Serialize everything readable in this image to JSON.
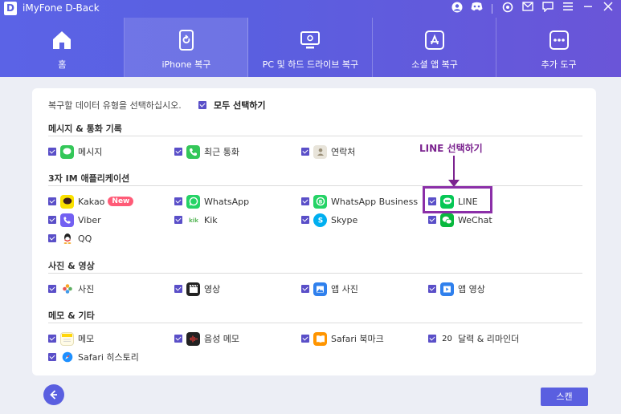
{
  "app": {
    "logo_letter": "D",
    "title": "iMyFone D-Back"
  },
  "titlebar_icons": [
    "user-icon",
    "discord-icon",
    "settings-icon",
    "mail-icon",
    "chat-icon",
    "menu-icon",
    "minimize-icon",
    "close-icon"
  ],
  "nav": {
    "tabs": [
      {
        "label": "홈",
        "icon": "home-icon",
        "active": false
      },
      {
        "label": "iPhone 복구",
        "icon": "phone-restore-icon",
        "active": true
      },
      {
        "label": "PC 및 하드 드라이브 복구",
        "icon": "monitor-icon",
        "active": false
      },
      {
        "label": "소셜 앱 복구",
        "icon": "app-store-icon",
        "active": false
      },
      {
        "label": "추가 도구",
        "icon": "more-tools-icon",
        "active": false
      }
    ]
  },
  "main": {
    "prompt": "복구할 데이터 유형을 선택하십시오.",
    "select_all_label": "모두 선택하기",
    "annotation": "LINE 선택하기",
    "sections": [
      {
        "title": "메시지 & 통화 기록",
        "items": [
          {
            "label": "메시지",
            "icon": "messages-icon",
            "color": "#34c759",
            "checked": true
          },
          {
            "label": "최근 통화",
            "icon": "phone-icon",
            "color": "#34c759",
            "checked": true
          },
          {
            "label": "연락처",
            "icon": "contacts-icon",
            "color": "#d8d3c7",
            "checked": true
          }
        ]
      },
      {
        "title": "3자 IM 애플리케이션",
        "items": [
          {
            "label": "Kakao",
            "icon": "kakao-icon",
            "color": "#fae100",
            "badge": "New",
            "checked": true
          },
          {
            "label": "WhatsApp",
            "icon": "whatsapp-icon",
            "color": "#25d366",
            "checked": true
          },
          {
            "label": "WhatsApp Business",
            "icon": "whatsapp-business-icon",
            "color": "#25d366",
            "checked": true
          },
          {
            "label": "LINE",
            "icon": "line-icon",
            "color": "#06c755",
            "checked": true
          },
          {
            "label": "Viber",
            "icon": "viber-icon",
            "color": "#7360f2",
            "checked": true
          },
          {
            "label": "Kik",
            "icon": "kik-icon",
            "color": "#ffffff",
            "checked": true
          },
          {
            "label": "Skype",
            "icon": "skype-icon",
            "color": "#00aff0",
            "checked": true
          },
          {
            "label": "WeChat",
            "icon": "wechat-icon",
            "color": "#09b83e",
            "checked": true
          },
          {
            "label": "QQ",
            "icon": "qq-icon",
            "color": "#ffffff",
            "checked": true
          }
        ]
      },
      {
        "title": "사진 & 영상",
        "items": [
          {
            "label": "사진",
            "icon": "photos-icon",
            "color": "#ffffff",
            "checked": true
          },
          {
            "label": "영상",
            "icon": "video-clapper-icon",
            "color": "#222222",
            "checked": true
          },
          {
            "label": "앱 사진",
            "icon": "app-photo-icon",
            "color": "#2f80ed",
            "checked": true
          },
          {
            "label": "앱 영상",
            "icon": "app-video-icon",
            "color": "#2f80ed",
            "checked": true
          }
        ]
      },
      {
        "title": "메모 & 기타",
        "items": [
          {
            "label": "메모",
            "icon": "notes-icon",
            "color": "#ffd60a",
            "checked": true
          },
          {
            "label": "음성 메모",
            "icon": "voice-memo-icon",
            "color": "#222222",
            "checked": true
          },
          {
            "label": "Safari 북마크",
            "icon": "bookmarks-icon",
            "color": "#ff9500",
            "checked": true
          },
          {
            "label": "달력 & 리마인더",
            "icon": "calendar-icon",
            "color": "#ffffff",
            "calendar_day": "20",
            "checked": true
          },
          {
            "label": "Safari 히스토리",
            "icon": "safari-icon",
            "color": "#1e90ff",
            "checked": true
          }
        ]
      }
    ]
  },
  "footer": {
    "back_icon": "back-arrow-icon",
    "scan_label": "스캔"
  },
  "colors": {
    "accent": "#5a5fe0",
    "checkbox": "#5a4fc8",
    "highlight": "#8b2fa8",
    "new_badge": "#ff5b77"
  }
}
